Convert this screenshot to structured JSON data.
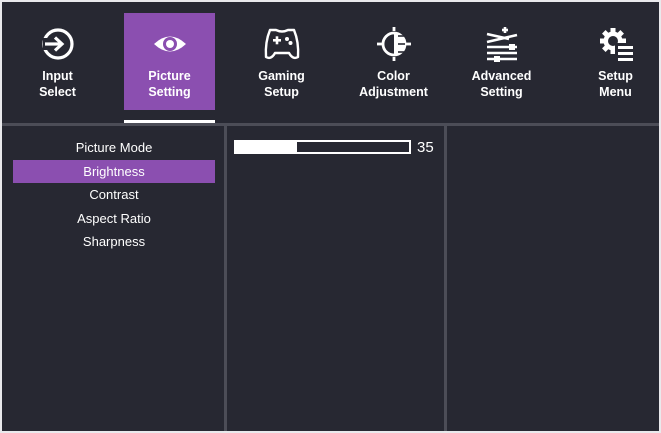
{
  "nav": {
    "items": [
      {
        "id": "input-select",
        "label": "Input\nSelect",
        "icon": "input-enter-icon"
      },
      {
        "id": "picture-setting",
        "label": "Picture\nSetting",
        "icon": "eye-icon",
        "active": true
      },
      {
        "id": "gaming-setup",
        "label": "Gaming\nSetup",
        "icon": "gamepad-icon"
      },
      {
        "id": "color-adjustment",
        "label": "Color\nAdjustment",
        "icon": "color-adjust-icon"
      },
      {
        "id": "advanced-setting",
        "label": "Advanced\nSetting",
        "icon": "advanced-lines-icon"
      },
      {
        "id": "setup-menu",
        "label": "Setup\nMenu",
        "icon": "gear-menu-icon"
      }
    ]
  },
  "submenu": {
    "items": [
      {
        "label": "Picture Mode"
      },
      {
        "label": "Brightness",
        "selected": true
      },
      {
        "label": "Contrast"
      },
      {
        "label": "Aspect Ratio"
      },
      {
        "label": "Sharpness"
      }
    ]
  },
  "brightness": {
    "value": "35",
    "level_percent": 35
  },
  "colors": {
    "background": "#272832",
    "accent": "#8b4fb0",
    "divider": "#4c4d57",
    "text": "#ffffff"
  }
}
